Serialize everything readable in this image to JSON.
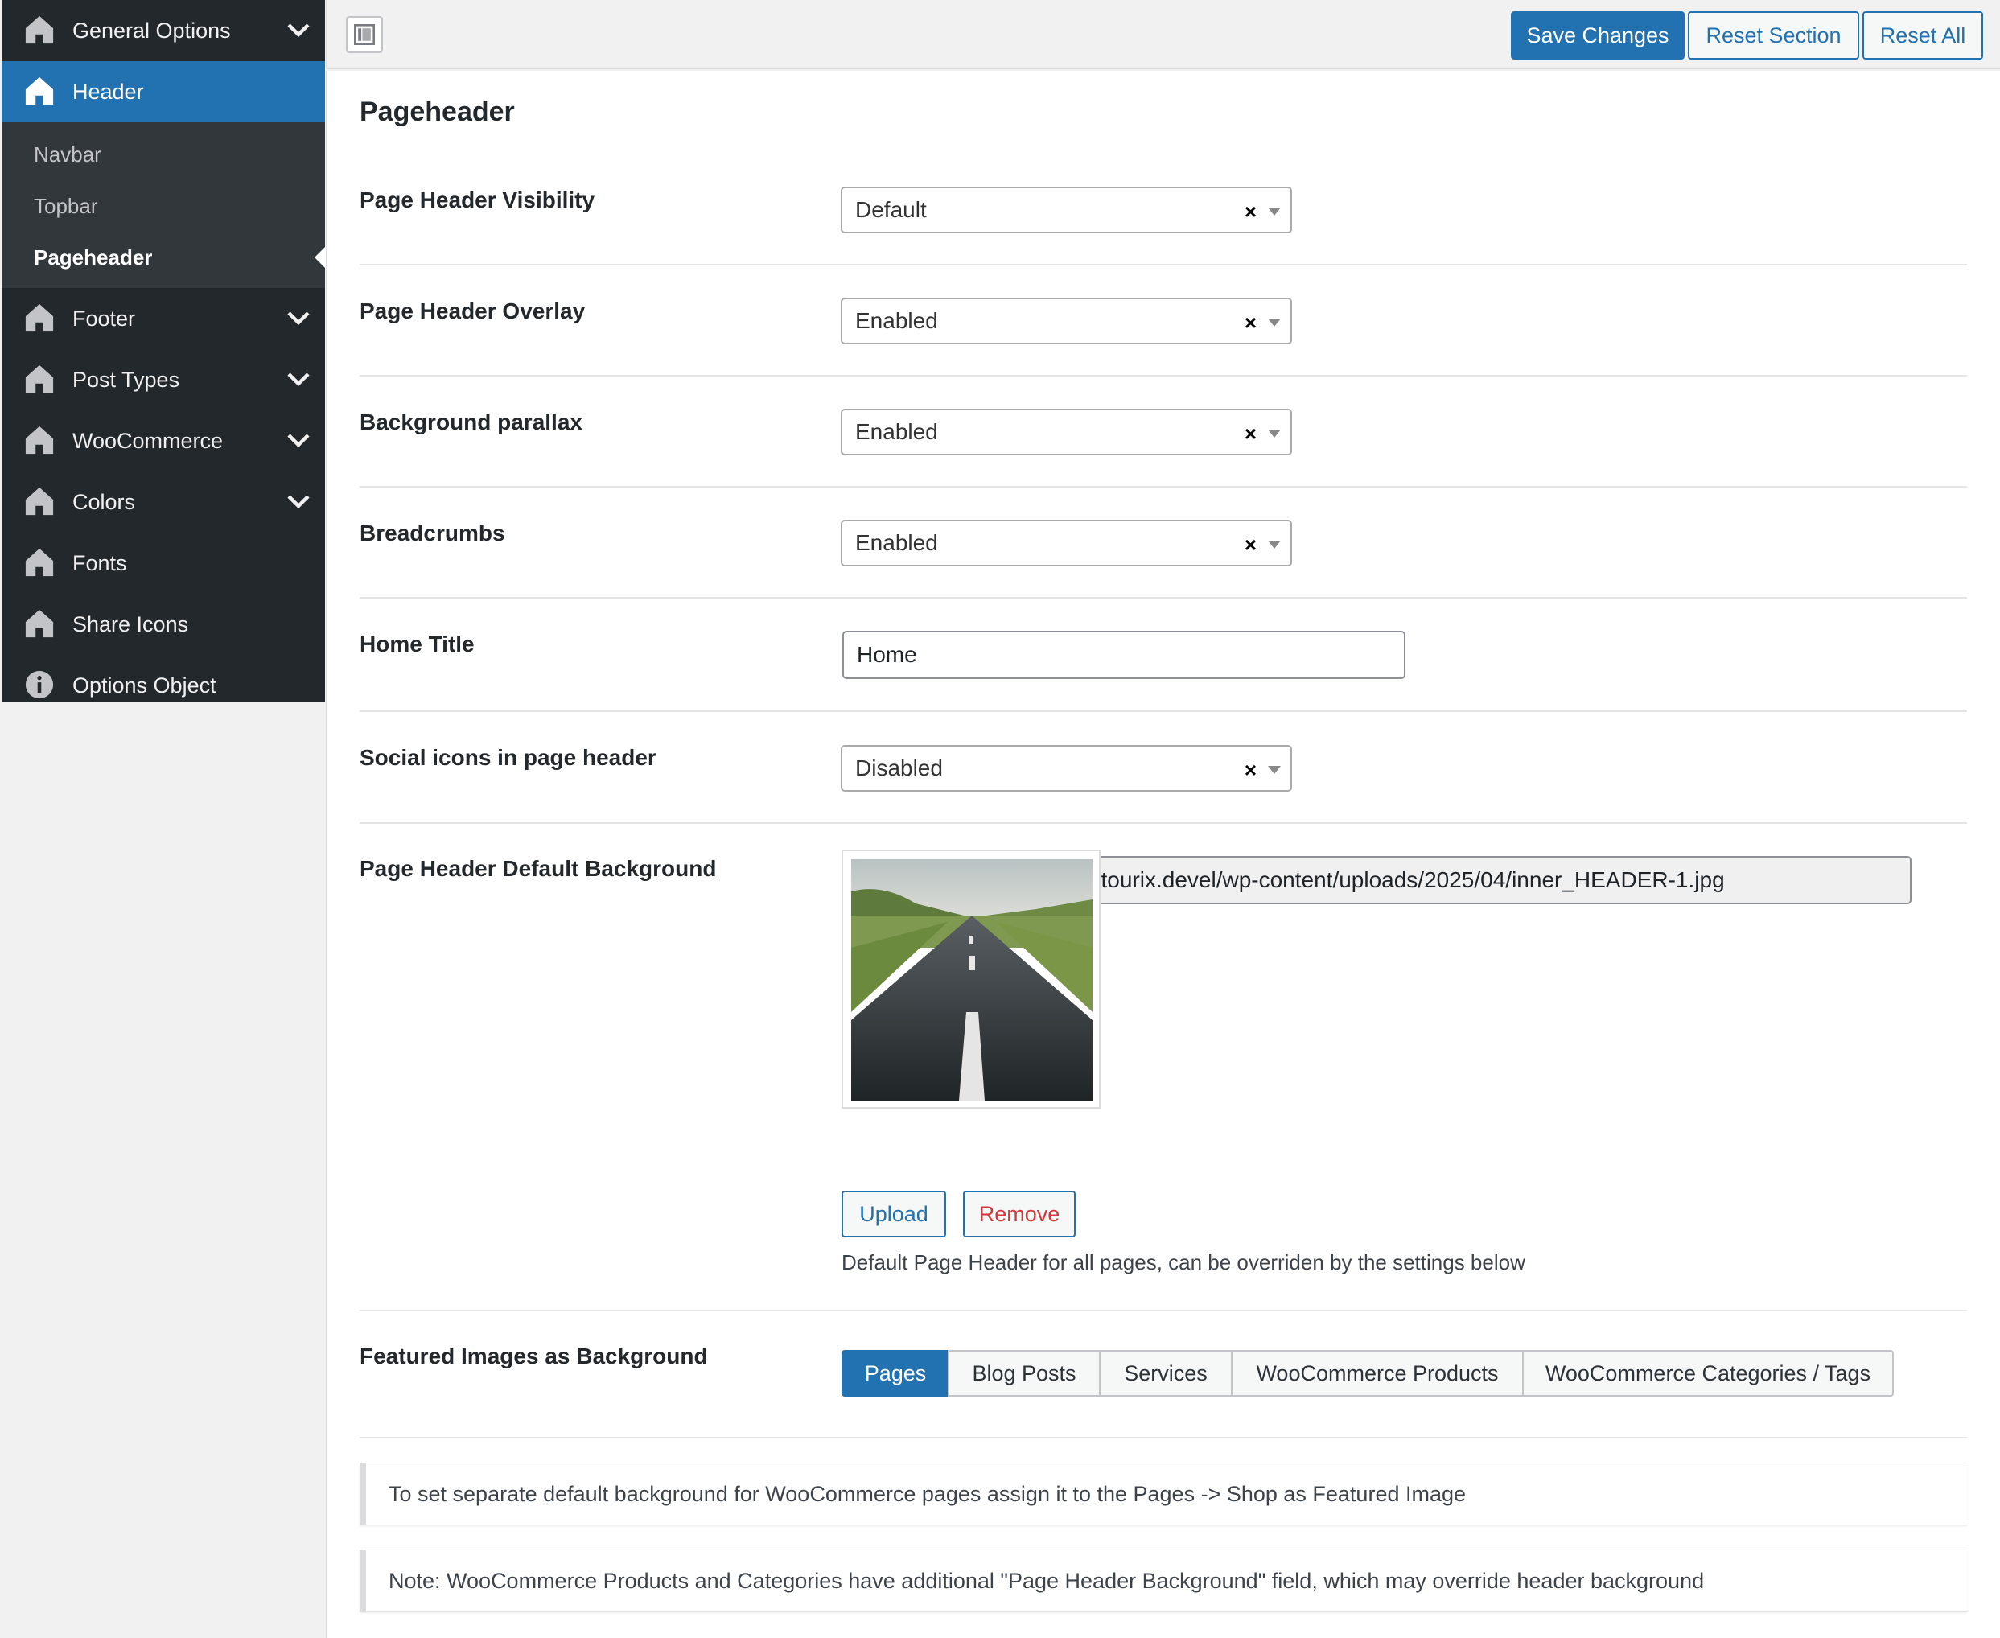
{
  "sidebar": {
    "items": [
      {
        "label": "General Options",
        "icon": "home-icon",
        "has_chevron": true
      },
      {
        "label": "Header",
        "icon": "home-icon",
        "active": true
      },
      {
        "label": "Footer",
        "icon": "home-icon",
        "has_chevron": true
      },
      {
        "label": "Post Types",
        "icon": "home-icon",
        "has_chevron": true
      },
      {
        "label": "WooCommerce",
        "icon": "home-icon",
        "has_chevron": true
      },
      {
        "label": "Colors",
        "icon": "home-icon",
        "has_chevron": true
      },
      {
        "label": "Fonts",
        "icon": "home-icon"
      },
      {
        "label": "Share Icons",
        "icon": "home-icon"
      },
      {
        "label": "Options Object",
        "icon": "info-icon"
      }
    ],
    "subitems": [
      {
        "label": "Navbar"
      },
      {
        "label": "Topbar"
      },
      {
        "label": "Pageheader",
        "current": true
      }
    ]
  },
  "toolbar": {
    "save_label": "Save Changes",
    "reset_section_label": "Reset Section",
    "reset_all_label": "Reset All"
  },
  "section": {
    "title": "Pageheader",
    "fields": {
      "visibility": {
        "label": "Page Header Visibility",
        "value": "Default"
      },
      "overlay": {
        "label": "Page Header Overlay",
        "value": "Enabled"
      },
      "parallax": {
        "label": "Background parallax",
        "value": "Enabled"
      },
      "breadcrumbs": {
        "label": "Breadcrumbs",
        "value": "Enabled"
      },
      "home_title": {
        "label": "Home Title",
        "value": "Home"
      },
      "social": {
        "label": "Social icons in page header",
        "value": "Disabled"
      },
      "default_bg": {
        "label": "Page Header Default Background",
        "url": "http://localhost:8888/wp-tourix.devel/wp-content/uploads/2025/04/inner_HEADER-1.jpg",
        "upload_label": "Upload",
        "remove_label": "Remove",
        "description": "Default Page Header for all pages, can be overriden by the settings below"
      },
      "featured": {
        "label": "Featured Images as Background",
        "options": [
          "Pages",
          "Blog Posts",
          "Services",
          "WooCommerce Products",
          "WooCommerce Categories / Tags"
        ],
        "selected": "Pages"
      }
    },
    "notices": [
      "To set separate default background for WooCommerce pages assign it to the Pages -> Shop as Featured Image",
      "Note: WooCommerce Products and Categories have additional \"Page Header Background\" field, which may override header background"
    ]
  },
  "colors": {
    "accent": "#2271b1",
    "sidebar_bg": "#23282d",
    "submenu_bg": "#32373c",
    "remove": "#d63638"
  }
}
